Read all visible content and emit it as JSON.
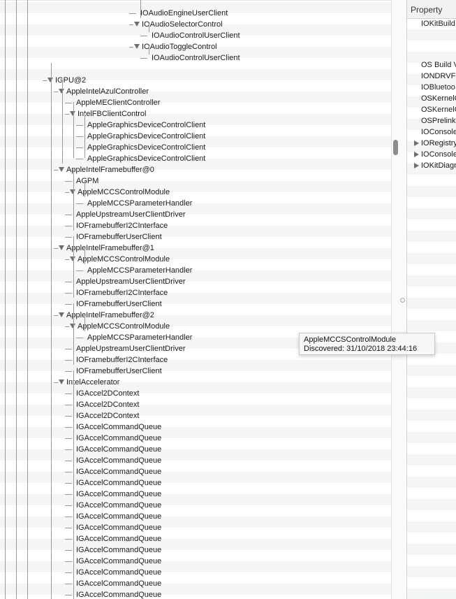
{
  "tree": {
    "rows": [
      {
        "label": "IOAudioEngineUserClient",
        "toggle": false
      },
      {
        "label": "IOAudioSelectorControl",
        "toggle": true
      },
      {
        "label": "IOAudioControlUserClient",
        "toggle": false
      },
      {
        "label": "IOAudioToggleControl",
        "toggle": true
      },
      {
        "label": "IOAudioControlUserClient",
        "toggle": false
      },
      {
        "label": "",
        "toggle": false
      },
      {
        "label": "IGPU@2",
        "toggle": true
      },
      {
        "label": "AppleIntelAzulController",
        "toggle": true
      },
      {
        "label": "AppleMEClientController",
        "toggle": false
      },
      {
        "label": "IntelFBClientControl",
        "toggle": true
      },
      {
        "label": "AppleGraphicsDeviceControlClient",
        "toggle": false
      },
      {
        "label": "AppleGraphicsDeviceControlClient",
        "toggle": false
      },
      {
        "label": "AppleGraphicsDeviceControlClient",
        "toggle": false
      },
      {
        "label": "AppleGraphicsDeviceControlClient",
        "toggle": false
      },
      {
        "label": "AppleIntelFramebuffer@0",
        "toggle": true
      },
      {
        "label": "AGPM",
        "toggle": false
      },
      {
        "label": "AppleMCCSControlModule",
        "toggle": true
      },
      {
        "label": "AppleMCCSParameterHandler",
        "toggle": false
      },
      {
        "label": "AppleUpstreamUserClientDriver",
        "toggle": false
      },
      {
        "label": "IOFramebufferI2CInterface",
        "toggle": false
      },
      {
        "label": "IOFramebufferUserClient",
        "toggle": false
      },
      {
        "label": "AppleIntelFramebuffer@1",
        "toggle": true
      },
      {
        "label": "AppleMCCSControlModule",
        "toggle": true
      },
      {
        "label": "AppleMCCSParameterHandler",
        "toggle": false
      },
      {
        "label": "AppleUpstreamUserClientDriver",
        "toggle": false
      },
      {
        "label": "IOFramebufferI2CInterface",
        "toggle": false
      },
      {
        "label": "IOFramebufferUserClient",
        "toggle": false
      },
      {
        "label": "AppleIntelFramebuffer@2",
        "toggle": true
      },
      {
        "label": "AppleMCCSControlModule",
        "toggle": true
      },
      {
        "label": "AppleMCCSParameterHandler",
        "toggle": false
      },
      {
        "label": "AppleUpstreamUserClientDriver",
        "toggle": false
      },
      {
        "label": "IOFramebufferI2CInterface",
        "toggle": false
      },
      {
        "label": "IOFramebufferUserClient",
        "toggle": false
      },
      {
        "label": "IntelAccelerator",
        "toggle": true
      },
      {
        "label": "IGAccel2DContext",
        "toggle": false
      },
      {
        "label": "IGAccel2DContext",
        "toggle": false
      },
      {
        "label": "IGAccel2DContext",
        "toggle": false
      },
      {
        "label": "IGAccelCommandQueue",
        "toggle": false
      },
      {
        "label": "IGAccelCommandQueue",
        "toggle": false
      },
      {
        "label": "IGAccelCommandQueue",
        "toggle": false
      },
      {
        "label": "IGAccelCommandQueue",
        "toggle": false
      },
      {
        "label": "IGAccelCommandQueue",
        "toggle": false
      },
      {
        "label": "IGAccelCommandQueue",
        "toggle": false
      },
      {
        "label": "IGAccelCommandQueue",
        "toggle": false
      },
      {
        "label": "IGAccelCommandQueue",
        "toggle": false
      },
      {
        "label": "IGAccelCommandQueue",
        "toggle": false
      },
      {
        "label": "IGAccelCommandQueue",
        "toggle": false
      },
      {
        "label": "IGAccelCommandQueue",
        "toggle": false
      },
      {
        "label": "IGAccelCommandQueue",
        "toggle": false
      },
      {
        "label": "IGAccelCommandQueue",
        "toggle": false
      },
      {
        "label": "IGAccelCommandQueue",
        "toggle": false
      },
      {
        "label": "IGAccelCommandQueue",
        "toggle": false
      },
      {
        "label": "IGAccelCommandQueue",
        "toggle": false
      }
    ]
  },
  "properties": {
    "header": "Property",
    "rows": [
      {
        "label": "IOKitBuild",
        "expandable": false
      },
      {
        "label": "OS Build V",
        "expandable": false
      },
      {
        "label": "IONDRVFr",
        "expandable": false
      },
      {
        "label": "IOBluetoo",
        "expandable": false
      },
      {
        "label": "OSKernelC",
        "expandable": false
      },
      {
        "label": "OSKernelC",
        "expandable": false
      },
      {
        "label": "OSPrelink",
        "expandable": false
      },
      {
        "label": "IOConsole",
        "expandable": false
      },
      {
        "label": "IORegistry",
        "expandable": true
      },
      {
        "label": "IOConsole",
        "expandable": true
      },
      {
        "label": "IOKitDiagn",
        "expandable": true
      }
    ]
  },
  "tooltip": {
    "title": "AppleMCCSControlModule",
    "detail": "Discovered: 31/10/2018 23:44:16"
  }
}
